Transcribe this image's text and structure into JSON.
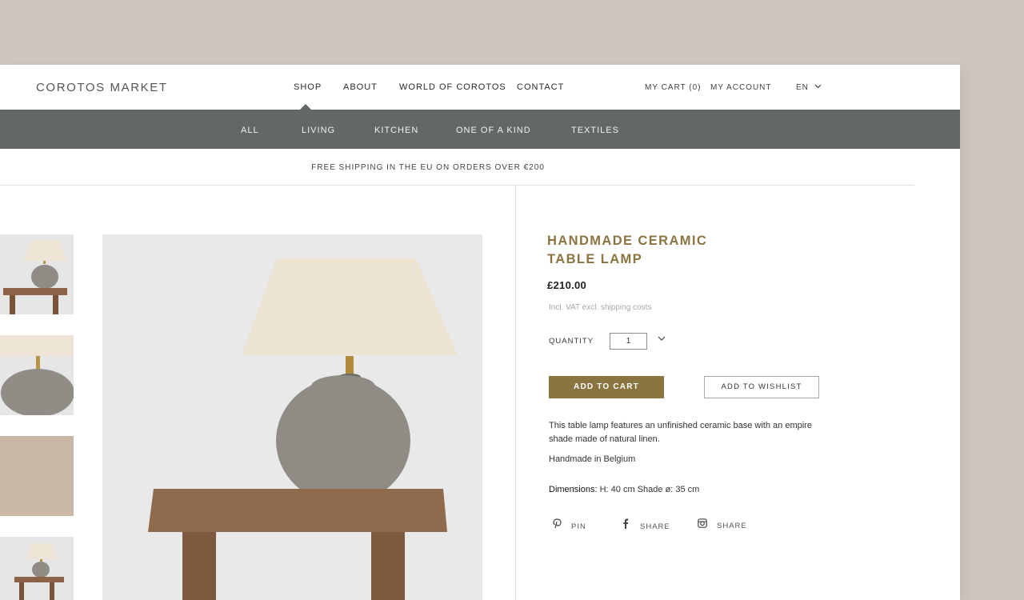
{
  "header": {
    "logo": "COROTOS MARKET",
    "nav": [
      "SHOP",
      "ABOUT",
      "WORLD OF COROTOS",
      "CONTACT"
    ],
    "cart": "MY CART (0)",
    "account": "MY ACCOUNT",
    "language": "EN"
  },
  "categories": [
    "ALL",
    "LIVING",
    "KITCHEN",
    "ONE OF A KIND",
    "TEXTILES"
  ],
  "shipping_banner": "FREE SHIPPING IN THE EU ON ORDERS OVER €200",
  "product": {
    "title": "HANDMADE CERAMIC TABLE LAMP",
    "price": "£210.00",
    "vat_note": "Incl. VAT excl. shipping costs",
    "quantity_label": "QUANTITY",
    "quantity": "1",
    "add_to_cart": "ADD TO CART",
    "add_to_wishlist": "ADD TO WISHLIST",
    "description": "This table lamp features an unfinished ceramic base with an empire shade made of natural linen.",
    "origin": "Handmade in Belgium",
    "dimensions_label": "Dimensions:",
    "dimensions_value": "H: 40 cm Shade ø: 35 cm"
  },
  "share": [
    {
      "icon": "pinterest-icon",
      "label": "PIN"
    },
    {
      "icon": "facebook-icon",
      "label": "SHARE"
    },
    {
      "icon": "instagram-icon",
      "label": "SHARE"
    }
  ],
  "colors": {
    "accent": "#8a7440",
    "category_bar": "#616866",
    "backdrop": "#cec7c0"
  }
}
